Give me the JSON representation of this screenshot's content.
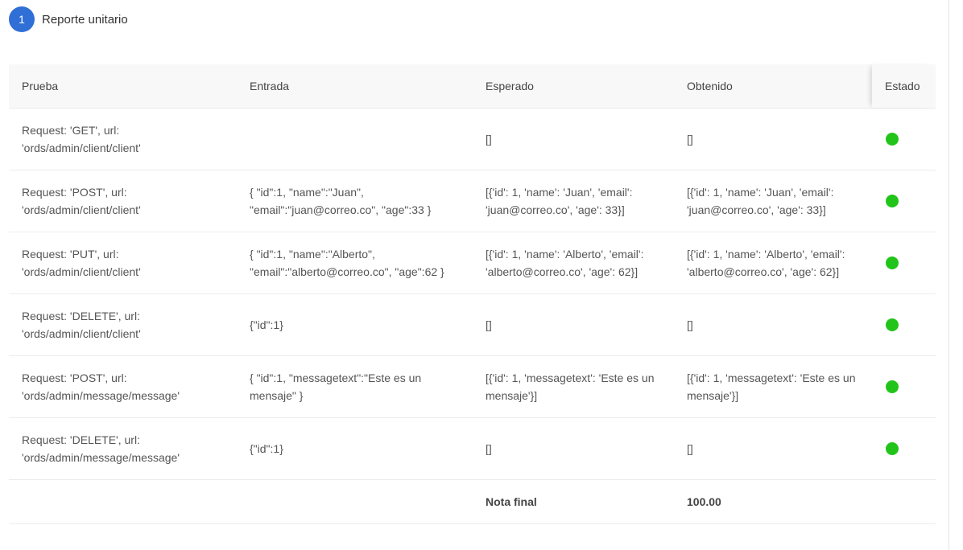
{
  "step": {
    "number": "1",
    "title": "Reporte unitario"
  },
  "table": {
    "headers": [
      "Prueba",
      "Entrada",
      "Esperado",
      "Obtenido",
      "Estado"
    ],
    "rows": [
      {
        "prueba": "Request: 'GET', url:\n'ords/admin/client/client'",
        "entrada": "",
        "esperado": "[]",
        "obtenido": "[]",
        "estado": "passed"
      },
      {
        "prueba": "Request: 'POST', url:\n'ords/admin/client/client'",
        "entrada": "{ \"id\":1, \"name\":\"Juan\",\n\"email\":\"juan@correo.co\", \"age\":33 }",
        "esperado": "[{'id': 1, 'name': 'Juan', 'email':\n'juan@correo.co', 'age': 33}]",
        "obtenido": "[{'id': 1, 'name': 'Juan', 'email':\n'juan@correo.co', 'age': 33}]",
        "estado": "passed"
      },
      {
        "prueba": "Request: 'PUT', url:\n'ords/admin/client/client'",
        "entrada": "{ \"id\":1, \"name\":\"Alberto\",\n\"email\":\"alberto@correo.co\", \"age\":62 }",
        "esperado": "[{'id': 1, 'name': 'Alberto', 'email':\n'alberto@correo.co', 'age': 62}]",
        "obtenido": "[{'id': 1, 'name': 'Alberto', 'email':\n'alberto@correo.co', 'age': 62}]",
        "estado": "passed"
      },
      {
        "prueba": "Request: 'DELETE', url:\n'ords/admin/client/client'",
        "entrada": "{\"id\":1}",
        "esperado": "[]",
        "obtenido": "[]",
        "estado": "passed"
      },
      {
        "prueba": "Request: 'POST', url:\n'ords/admin/message/message'",
        "entrada": "{ \"id\":1, \"messagetext\":\"Este es un\nmensaje\" }",
        "esperado": "[{'id': 1, 'messagetext': 'Este es un\nmensaje'}]",
        "obtenido": "[{'id': 1, 'messagetext': 'Este es un\nmensaje'}]",
        "estado": "passed"
      },
      {
        "prueba": "Request: 'DELETE', url:\n'ords/admin/message/message'",
        "entrada": "{\"id\":1}",
        "esperado": "[]",
        "obtenido": "[]",
        "estado": "passed"
      }
    ],
    "footer": {
      "label": "Nota final",
      "value": "100.00"
    }
  },
  "colors": {
    "accent": "#2f6fd6",
    "status_ok": "#22c41a"
  },
  "icons": {
    "status": "status-ok-icon"
  }
}
